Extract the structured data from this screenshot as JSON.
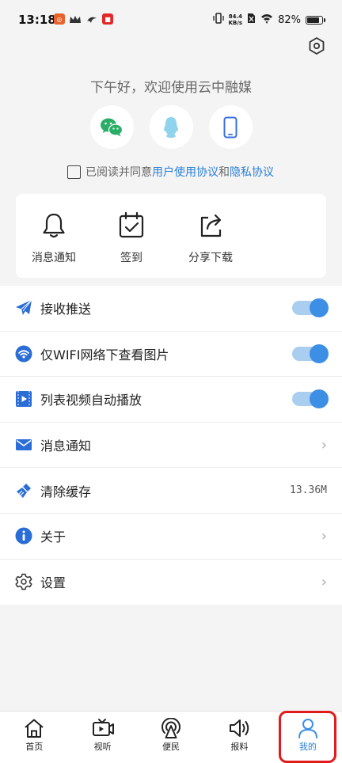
{
  "status_bar": {
    "time": "13:18",
    "net_speed_value": "84.4",
    "net_speed_unit": "KB/s",
    "battery": "82%",
    "battery_level": 0.82
  },
  "greeting": "下午好，欢迎使用云中融媒",
  "login": {
    "methods": [
      {
        "icon": "wechat-icon",
        "color": "#2aae67"
      },
      {
        "icon": "qq-icon",
        "color": "#8fd3ec"
      },
      {
        "icon": "phone-icon",
        "color": "#3a6fe0"
      }
    ]
  },
  "agreement": {
    "prefix": "已阅读并同意",
    "user_agreement": "用户使用协议",
    "conjunction": "和",
    "privacy_agreement": "隐私协议"
  },
  "quick_actions": [
    {
      "label": "消息通知",
      "icon": "bell-icon"
    },
    {
      "label": "签到",
      "icon": "calendar-check-icon"
    },
    {
      "label": "分享下载",
      "icon": "share-icon"
    }
  ],
  "settings": [
    {
      "label": "接收推送",
      "icon": "paper-plane-icon",
      "type": "toggle",
      "on": true
    },
    {
      "label": "仅WIFI网络下查看图片",
      "icon": "wifi-icon",
      "type": "toggle",
      "on": true
    },
    {
      "label": "列表视频自动播放",
      "icon": "video-icon",
      "type": "toggle",
      "on": true
    },
    {
      "label": "消息通知",
      "icon": "envelope-icon",
      "type": "chevron"
    },
    {
      "label": "清除缓存",
      "icon": "broom-icon",
      "type": "value",
      "value": "13.36M"
    },
    {
      "label": "关于",
      "icon": "info-icon",
      "type": "chevron"
    },
    {
      "label": "设置",
      "icon": "gear-icon",
      "type": "chevron"
    }
  ],
  "tabs": [
    {
      "label": "首页",
      "icon": "home-icon"
    },
    {
      "label": "视听",
      "icon": "tv-icon"
    },
    {
      "label": "便民",
      "icon": "broadcast-icon"
    },
    {
      "label": "报料",
      "icon": "speaker-icon"
    },
    {
      "label": "我的",
      "icon": "user-icon",
      "active": true
    }
  ],
  "colors": {
    "accent": "#3d8fe6",
    "link": "#2a7fd8",
    "highlight": "#e11b1b"
  }
}
